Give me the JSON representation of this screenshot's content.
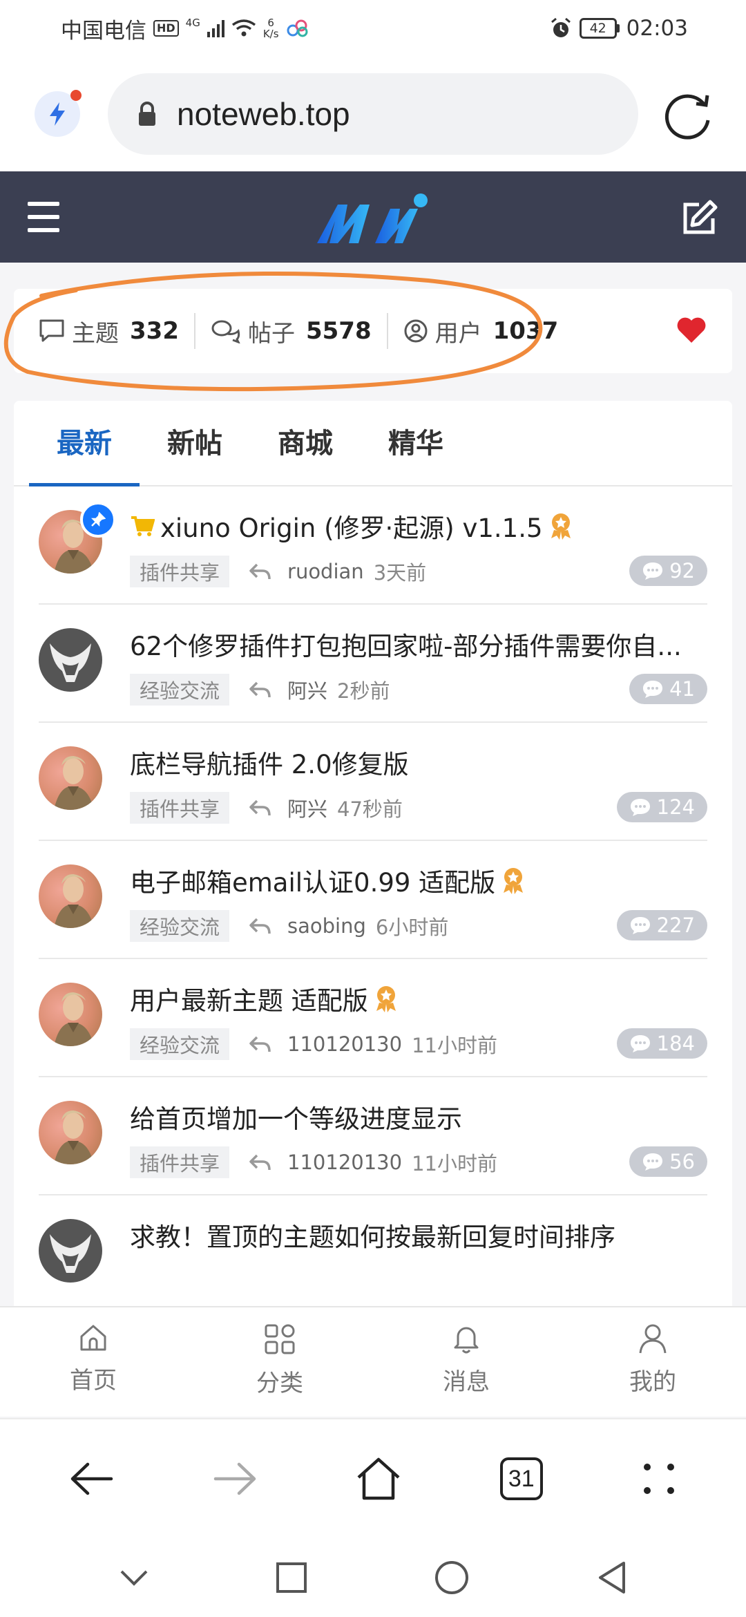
{
  "status_bar": {
    "carrier": "中国电信",
    "hd": "HD",
    "network": "4G",
    "speed_value": "6",
    "speed_unit": "K/s",
    "battery": "42",
    "time": "02:03"
  },
  "browser": {
    "url": "noteweb.top",
    "tab_count": "31"
  },
  "stats": [
    {
      "label": "主题",
      "value": "332"
    },
    {
      "label": "帖子",
      "value": "5578"
    },
    {
      "label": "用户",
      "value": "1037"
    }
  ],
  "tabs": [
    {
      "label": "最新",
      "active": true
    },
    {
      "label": "新帖",
      "active": false
    },
    {
      "label": "商城",
      "active": false
    },
    {
      "label": "精华",
      "active": false
    }
  ],
  "threads": [
    {
      "title": "xiuno Origin (修罗·起源) v1.1.5",
      "category": "插件共享",
      "user": "ruodian",
      "time": "3天前",
      "replies": "92",
      "pinned": true,
      "cart": true,
      "medal": true,
      "avatar": "photo"
    },
    {
      "title": "62个修罗插件打包抱回家啦-部分插件需要你自...",
      "category": "经验交流",
      "user": "阿兴",
      "time": "2秒前",
      "replies": "41",
      "pinned": false,
      "cart": false,
      "medal": false,
      "avatar": "logo"
    },
    {
      "title": "底栏导航插件 2.0修复版",
      "category": "插件共享",
      "user": "阿兴",
      "time": "47秒前",
      "replies": "124",
      "pinned": false,
      "cart": false,
      "medal": false,
      "avatar": "photo"
    },
    {
      "title": "电子邮箱email认证0.99 适配版",
      "category": "经验交流",
      "user": "saobing",
      "time": "6小时前",
      "replies": "227",
      "pinned": false,
      "cart": false,
      "medal": true,
      "avatar": "photo"
    },
    {
      "title": "用户最新主题 适配版",
      "category": "经验交流",
      "user": "110120130",
      "time": "11小时前",
      "replies": "184",
      "pinned": false,
      "cart": false,
      "medal": true,
      "avatar": "photo"
    },
    {
      "title": "给首页增加一个等级进度显示",
      "category": "插件共享",
      "user": "110120130",
      "time": "11小时前",
      "replies": "56",
      "pinned": false,
      "cart": false,
      "medal": false,
      "avatar": "photo"
    },
    {
      "title": "求教！置顶的主题如何按最新回复时间排序",
      "category": "",
      "user": "",
      "time": "",
      "replies": "",
      "pinned": false,
      "cart": false,
      "medal": false,
      "avatar": "logo"
    }
  ],
  "site_nav": [
    {
      "label": "首页",
      "icon": "home-icon"
    },
    {
      "label": "分类",
      "icon": "category-icon"
    },
    {
      "label": "消息",
      "icon": "bell-icon"
    },
    {
      "label": "我的",
      "icon": "user-icon"
    }
  ],
  "colors": {
    "accent": "#1a66c2",
    "header_bg": "#3b3f52",
    "heart": "#e0262e",
    "annotation_circle": "#f08a3c",
    "medal": "#f0a43a"
  }
}
